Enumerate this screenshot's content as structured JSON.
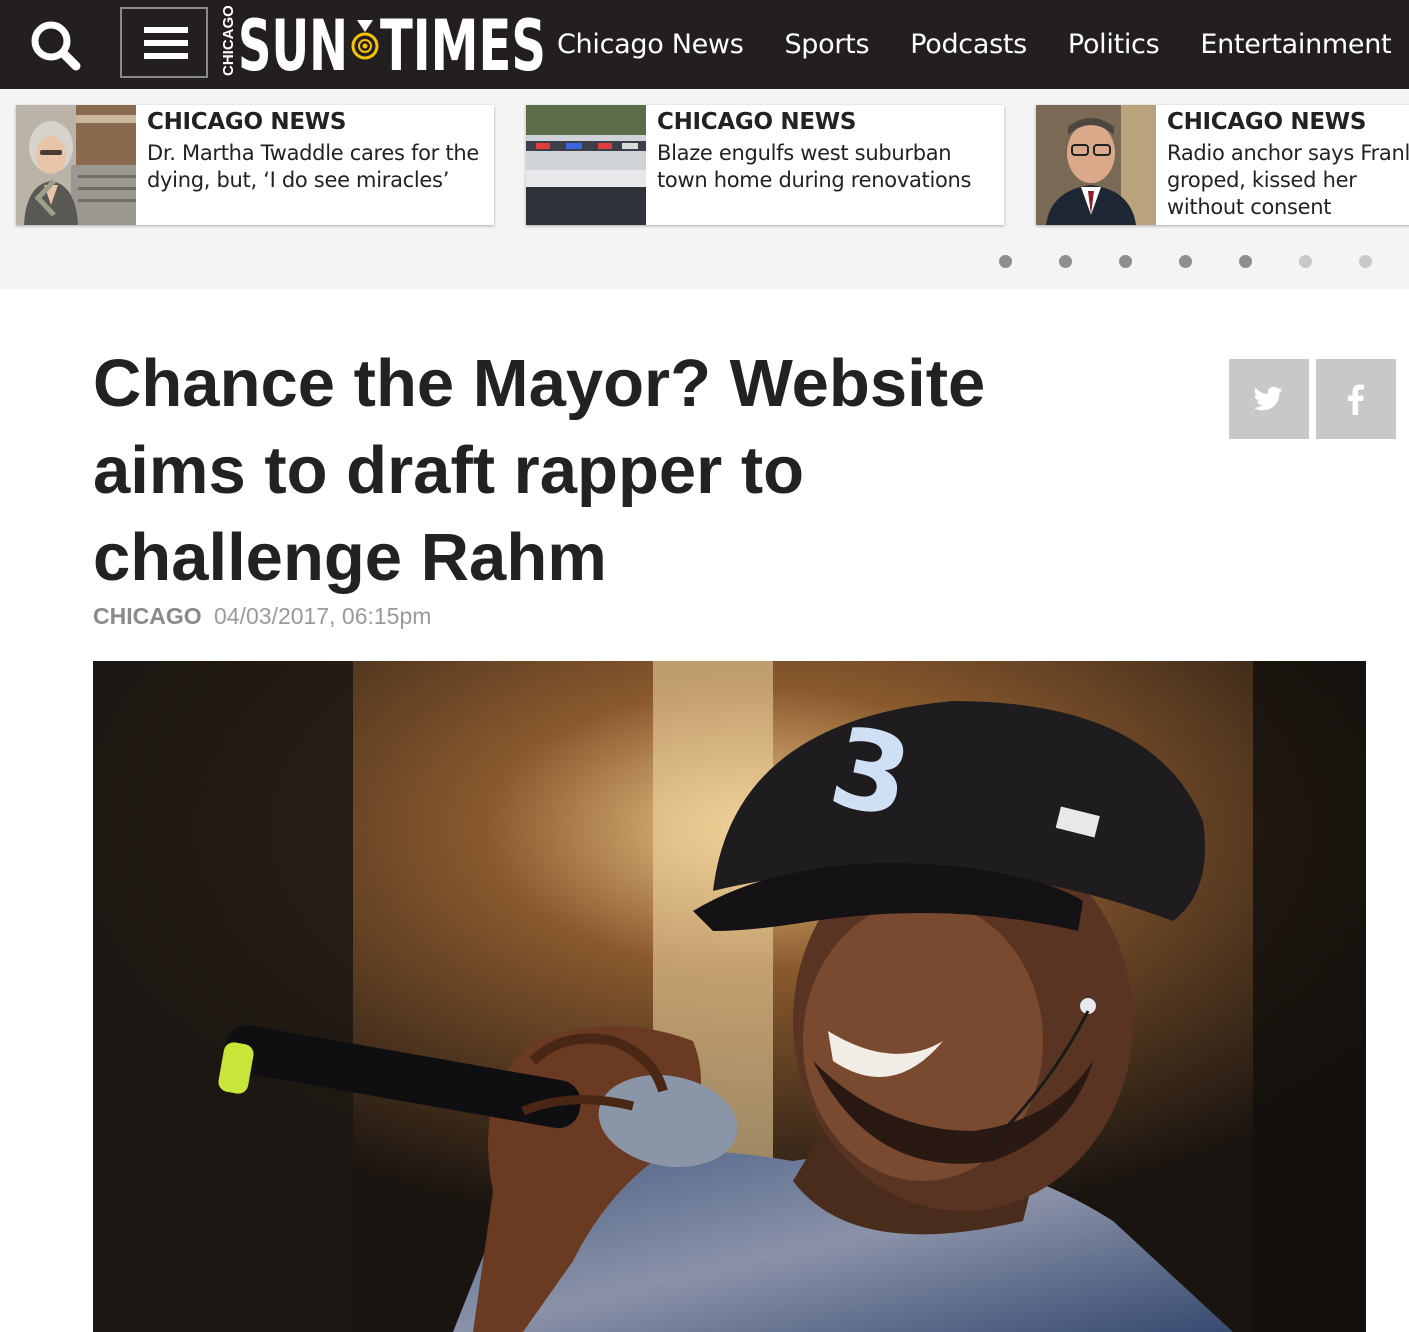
{
  "colors": {
    "topbar": "#231f20",
    "nav_text": "#ffffff",
    "logo_accent": "#f5c400",
    "ticker_bg": "#f4f4f4",
    "share_bg": "#c8c8c8",
    "dateline": "#9a9a9a",
    "dot_active": "#8f8f8f",
    "dot_inactive": "#c9c9c9"
  },
  "header": {
    "search_icon": "search-icon",
    "menu_icon": "hamburger-menu-icon",
    "logo": {
      "small": "CHICAGO",
      "left": "SUN",
      "right": "TIMES"
    },
    "nav": [
      "Chicago News",
      "Sports",
      "Podcasts",
      "Politics",
      "Entertainment"
    ]
  },
  "ticker": {
    "cards": [
      {
        "kicker": "CHICAGO NEWS",
        "headline": "Dr. Martha Twaddle cares for the dying, but, ‘I do see miracles’"
      },
      {
        "kicker": "CHICAGO NEWS",
        "headline": "Blaze engulfs west suburban town home during renovations"
      },
      {
        "kicker": "CHICAGO NEWS",
        "headline": "Radio anchor says Franl groped, kissed her without consent"
      }
    ],
    "dots": {
      "total": 7,
      "active_count": 5
    }
  },
  "article": {
    "headline": "Chance the Mayor? Website aims to draft rapper to challenge Rahm",
    "section": "CHICAGO",
    "timestamp": "04/03/2017, 06:15pm",
    "share": [
      "twitter-icon",
      "facebook-icon"
    ]
  }
}
